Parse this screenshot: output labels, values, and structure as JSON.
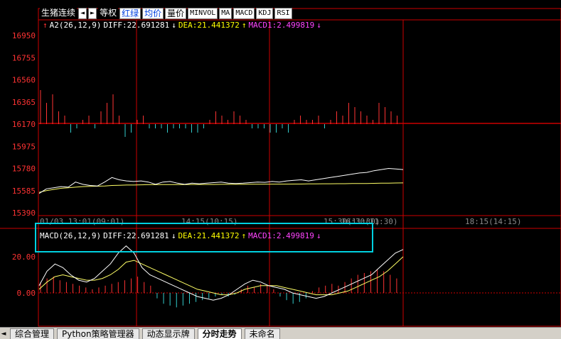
{
  "toolbar": {
    "title": "生猪连续",
    "buttons": [
      "等权",
      "红绿",
      "均价",
      "量价",
      "MINVOL",
      "MA",
      "MACD",
      "KDJ",
      "RSI"
    ]
  },
  "top_info": {
    "indicator": "A2(26,12,9)",
    "diff": "DIFF:22.691281",
    "dea": "DEA:21.441372",
    "macd1": "MACD1:2.499819"
  },
  "macd_info": {
    "indicator": "MACD(26,12,9)",
    "diff": "DIFF:22.691281",
    "dea": "DEA:21.441372",
    "macd1": "MACD1:2.499819"
  },
  "arrows": {
    "down": "↓",
    "up": "↑",
    "left": "◄",
    "right": "►",
    "top_red": "↑"
  },
  "colors": {
    "grid": "#cc0000",
    "price_line": "#ffffff",
    "avg_line": "#ffff66",
    "up_bar": "#ff3333",
    "down_bar": "#33cccc",
    "dea_line": "#ffff66",
    "diff_line": "#ffffff",
    "frame": "#00d0e0"
  },
  "chart_data": {
    "type": "line",
    "price_axis_labels": [
      "16950",
      "16755",
      "16560",
      "16365",
      "16170",
      "15975",
      "15780",
      "15585",
      "15390"
    ],
    "price_ylim": [
      15390,
      16950
    ],
    "baseline": 16170,
    "time_labels": [
      "01/03 13:01(09:01)",
      "14:15(10:15)",
      "15:30(11:30)",
      "16:30(11:30)",
      "18:15(14:15)"
    ],
    "macd_axis_labels": [
      "20.00",
      "0.00"
    ],
    "macd_ylim": [
      -8,
      30
    ],
    "price_series": [
      15560,
      15600,
      15610,
      15620,
      15615,
      15660,
      15640,
      15630,
      15625,
      15660,
      15700,
      15680,
      15670,
      15665,
      15670,
      15660,
      15640,
      15660,
      15665,
      15650,
      15640,
      15650,
      15645,
      15650,
      15655,
      15660,
      15650,
      15648,
      15650,
      15655,
      15660,
      15658,
      15665,
      15660,
      15670,
      15675,
      15680,
      15670,
      15680,
      15690,
      15700,
      15710,
      15720,
      15730,
      15740,
      15745,
      15760,
      15770,
      15780,
      15775,
      15770
    ],
    "avg_series": [
      15570,
      15585,
      15595,
      15605,
      15610,
      15615,
      15620,
      15622,
      15624,
      15626,
      15630,
      15632,
      15634,
      15634,
      15636,
      15637,
      15637,
      15638,
      15638,
      15638,
      15638,
      15639,
      15639,
      15639,
      15639,
      15640,
      15640,
      15640,
      15640,
      15641,
      15641,
      15641,
      15642,
      15642,
      15642,
      15643,
      15643,
      15644,
      15644,
      15645,
      15645,
      15646,
      15646,
      15647,
      15647,
      15648,
      15649,
      15650,
      15651,
      15652,
      15653
    ],
    "volume_bars": [
      8,
      5,
      7,
      3,
      2,
      -2,
      -1,
      1,
      2,
      -1,
      3,
      5,
      7,
      2,
      -3,
      -2,
      1,
      2,
      -1,
      -1,
      -1,
      -2,
      -1,
      -1,
      -1,
      -2,
      -2,
      -1,
      1,
      3,
      2,
      1,
      3,
      2,
      1,
      -1,
      -1,
      -1,
      -2,
      -2,
      -1,
      -2,
      1,
      2,
      1,
      1,
      2,
      -1,
      1,
      3,
      2,
      5,
      4,
      3,
      2,
      1,
      5,
      4,
      3,
      2
    ],
    "macd_bars": [
      6,
      8,
      9,
      7,
      6,
      5,
      4,
      3,
      2,
      3,
      4,
      5,
      6,
      7,
      8,
      9,
      6,
      4,
      -3,
      -6,
      -7,
      -8,
      -7,
      -6,
      -5,
      -4,
      -3,
      -2,
      -1,
      -2,
      -1,
      2,
      4,
      3,
      5,
      4,
      2,
      -2,
      -4,
      -6,
      -5,
      -3,
      1,
      3,
      4,
      5,
      4,
      6,
      8,
      10,
      11,
      12,
      13,
      12,
      10,
      8
    ],
    "diff_series": [
      4,
      12,
      16,
      14,
      10,
      7,
      6,
      8,
      12,
      16,
      22,
      26,
      22,
      14,
      10,
      8,
      6,
      4,
      2,
      0,
      -2,
      -3,
      -4,
      -3,
      -1,
      2,
      5,
      7,
      6,
      4,
      3,
      2,
      0,
      -1,
      -2,
      -3,
      -2,
      0,
      2,
      4,
      6,
      8,
      10,
      14,
      18,
      22,
      24
    ],
    "dea_series": [
      2,
      6,
      9,
      10,
      9,
      8,
      7,
      7,
      8,
      10,
      13,
      17,
      18,
      16,
      14,
      12,
      10,
      8,
      6,
      4,
      2,
      1,
      0,
      -1,
      -1,
      0,
      2,
      3,
      4,
      4,
      4,
      3,
      2,
      1,
      0,
      -1,
      -1,
      -1,
      0,
      1,
      3,
      5,
      7,
      9,
      12,
      16,
      20
    ]
  },
  "tabs": [
    "综合管理",
    "Python策略管理器",
    "动态显示牌",
    "分时走势",
    "未命名"
  ],
  "active_tab": "分时走势"
}
